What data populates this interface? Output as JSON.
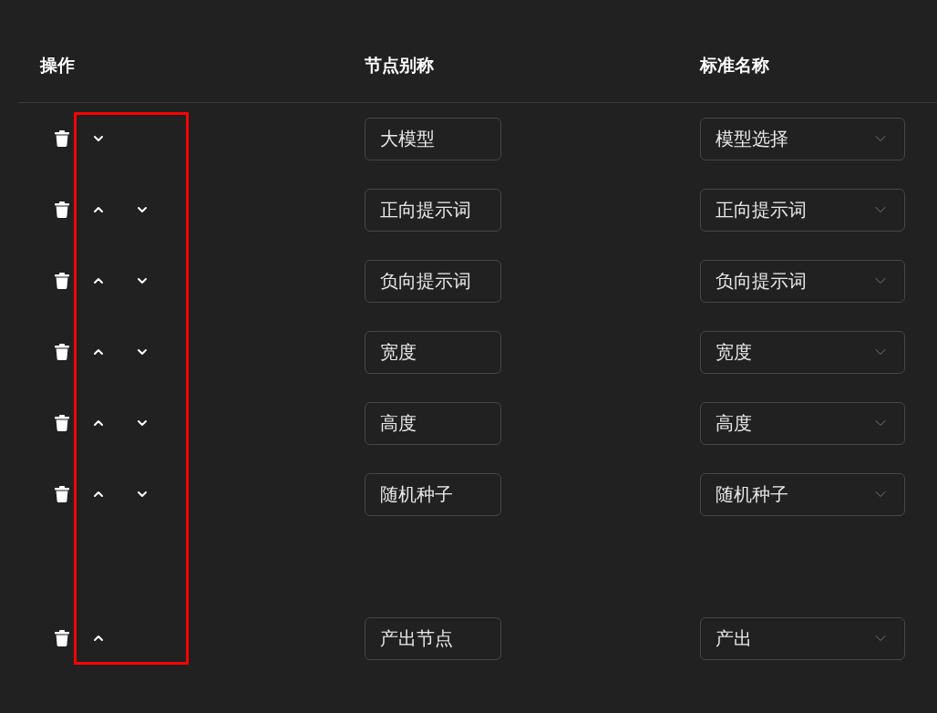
{
  "columns": [
    "操作",
    "节点别称",
    "标准名称"
  ],
  "rows": [
    {
      "can_move_up": false,
      "can_move_down": true,
      "alias": "大模型",
      "standard_name": "模型选择"
    },
    {
      "can_move_up": true,
      "can_move_down": true,
      "alias": "正向提示词",
      "standard_name": "正向提示词"
    },
    {
      "can_move_up": true,
      "can_move_down": true,
      "alias": "负向提示词",
      "standard_name": "负向提示词"
    },
    {
      "can_move_up": true,
      "can_move_down": true,
      "alias": "宽度",
      "standard_name": "宽度"
    },
    {
      "can_move_up": true,
      "can_move_down": true,
      "alias": "高度",
      "standard_name": "高度"
    },
    {
      "can_move_up": true,
      "can_move_down": true,
      "alias": "随机种子",
      "standard_name": "随机种子"
    },
    {
      "can_move_up": true,
      "can_move_down": false,
      "alias": "产出节点",
      "standard_name": "产出"
    }
  ]
}
